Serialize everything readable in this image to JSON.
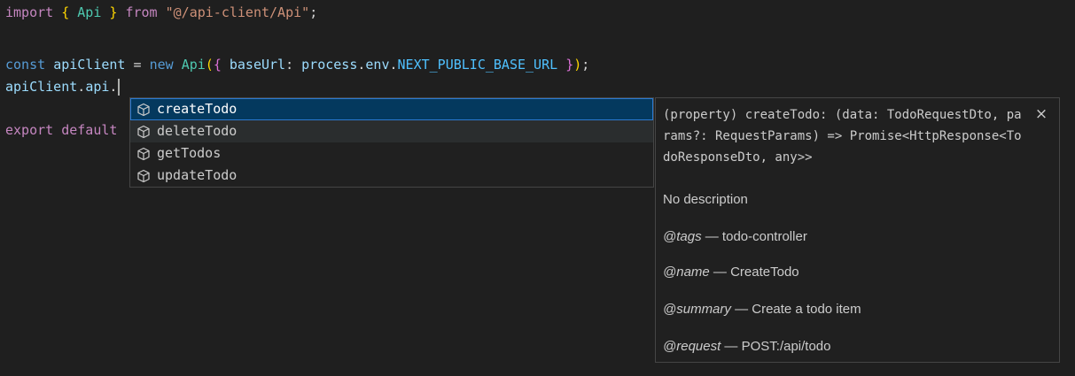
{
  "editor": {
    "line1": {
      "import_kw": "import",
      "brace_open": "{",
      "name": "Api",
      "brace_close": "}",
      "from_kw": "from",
      "path": "\"@/api-client/Api\"",
      "semi": ";"
    },
    "line3": {
      "const_kw": "const",
      "var": "apiClient",
      "eq": "=",
      "new_kw": "new",
      "cls": "Api",
      "paren_open": "(",
      "brace_open": "{",
      "prop": "baseUrl",
      "colon": ":",
      "obj": "process",
      "dot1": ".",
      "env": "env",
      "dot2": ".",
      "constant": "NEXT_PUBLIC_BASE_URL",
      "brace_close": "}",
      "paren_close": ")",
      "semi": ";"
    },
    "line4": {
      "var": "apiClient",
      "dot1": ".",
      "prop": "api",
      "dot2": "."
    },
    "line6": {
      "export_kw": "export",
      "default_kw": "default"
    }
  },
  "suggest": {
    "items": [
      {
        "label": "createTodo",
        "icon": "property-cube-icon",
        "selected": true
      },
      {
        "label": "deleteTodo",
        "icon": "property-cube-icon",
        "selected": false
      },
      {
        "label": "getTodos",
        "icon": "property-cube-icon",
        "selected": false
      },
      {
        "label": "updateTodo",
        "icon": "property-cube-icon",
        "selected": false
      }
    ]
  },
  "details": {
    "signature": "(property) createTodo: (data: TodoRequestDto, params?: RequestParams) => Promise<HttpResponse<TodoResponseDto, any>>",
    "close_glyph": "×",
    "description": "No description",
    "tags": {
      "tag": "@tags",
      "value": " — todo-controller"
    },
    "name": {
      "tag": "@name",
      "value": " — CreateTodo"
    },
    "summary": {
      "tag": "@summary",
      "value": " — Create a todo item"
    },
    "request": {
      "tag": "@request",
      "value": " — POST:/api/todo"
    }
  },
  "colors": {
    "background": "#1f1f1f",
    "selection": "#04395e",
    "keyword": "#c586c0",
    "storage": "#569cd6",
    "variable": "#9cdcfe",
    "class": "#4ec9b0",
    "string": "#ce9178",
    "constant": "#4fc1ff"
  }
}
